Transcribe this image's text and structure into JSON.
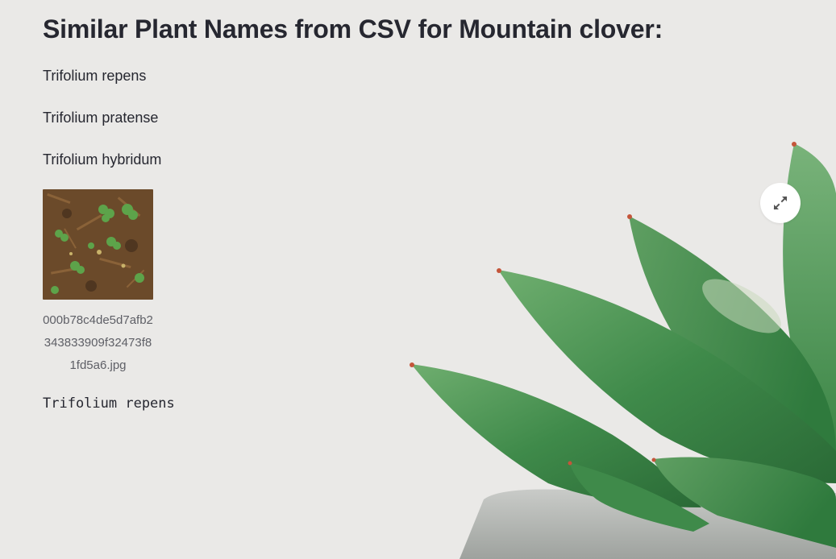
{
  "main": {
    "title": "Similar Plant Names from CSV for Mountain clover:",
    "similar_names": [
      "Trifolium repens",
      "Trifolium pratense",
      "Trifolium hybridum"
    ],
    "image": {
      "caption": "000b78c4de5d7afb2343833909f32473f81fd5a6.jpg"
    },
    "prediction_code": "Trifolium repens"
  },
  "controls": {
    "expand_icon": "expand-arrows-icon"
  },
  "colors": {
    "background": "#eae9e7",
    "text": "#262730",
    "caption": "#5e5f66",
    "leaf": "#3f8a4a"
  }
}
